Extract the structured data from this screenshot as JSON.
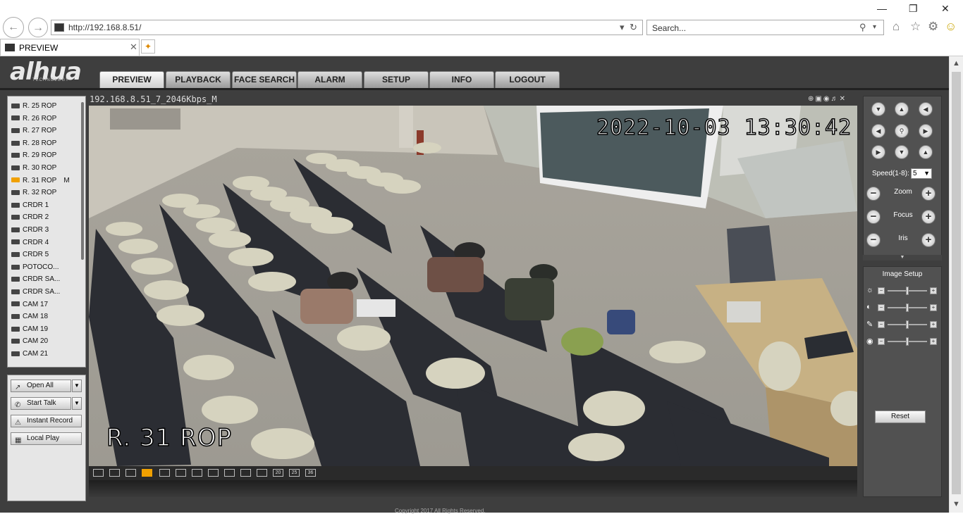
{
  "browser": {
    "url": "http://192.168.8.51/",
    "search_placeholder": "Search...",
    "tab_title": "PREVIEW"
  },
  "app": {
    "logo": "alhua",
    "logo_sub": "TECHNOLOGY",
    "nav": [
      "PREVIEW",
      "PLAYBACK",
      "FACE SEARCH",
      "ALARM",
      "SETUP",
      "INFO",
      "LOGOUT"
    ],
    "active_nav": "PREVIEW",
    "footer": "Copyright 2017 All Rights Reserved."
  },
  "channels": [
    "R. 25 ROP",
    "R. 26 ROP",
    "R. 27 ROP",
    "R. 28 ROP",
    "R. 29 ROP",
    "R. 30 ROP",
    "R. 31 ROP",
    "R. 32 ROP",
    "CRDR 1",
    "CRDR 2",
    "CRDR 3",
    "CRDR 4",
    "CRDR 5",
    "POTOCO...",
    "CRDR SA...",
    "CRDR SA...",
    "CAM 17",
    "CAM 18",
    "CAM 19",
    "CAM 20",
    "CAM 21"
  ],
  "active_channel": "R. 31 ROP",
  "active_channel_stream": "M",
  "actions": {
    "open_all": "Open All",
    "start_talk": "Start Talk",
    "instant_record": "Instant Record",
    "local_play": "Local Play"
  },
  "video": {
    "title": "192.168.8.51_7_2046Kbps_M",
    "timestamp": "2022-10-03 13:30:42",
    "camera_name": "R. 31 ROP"
  },
  "layout_buttons": [
    "fit",
    "stretch",
    "full",
    "mode",
    "1",
    "4",
    "6",
    "8",
    "9",
    "13",
    "16",
    "20",
    "25",
    "36"
  ],
  "active_layout": "mode",
  "ptz": {
    "speed_label": "Speed(1-8):",
    "speed_value": "5",
    "zoom_label": "Zoom",
    "focus_label": "Focus",
    "iris_label": "Iris"
  },
  "image_setup": {
    "title": "Image Setup",
    "reset_label": "Reset",
    "controls": [
      "brightness-icon",
      "contrast-icon",
      "saturation-icon",
      "hue-icon"
    ],
    "levels": [
      0.5,
      0.5,
      0.5,
      0.5
    ]
  },
  "colors": {
    "accent": "#f0a000",
    "panel_bg": "#3e3e3e",
    "list_bg": "#e6e6e6"
  }
}
